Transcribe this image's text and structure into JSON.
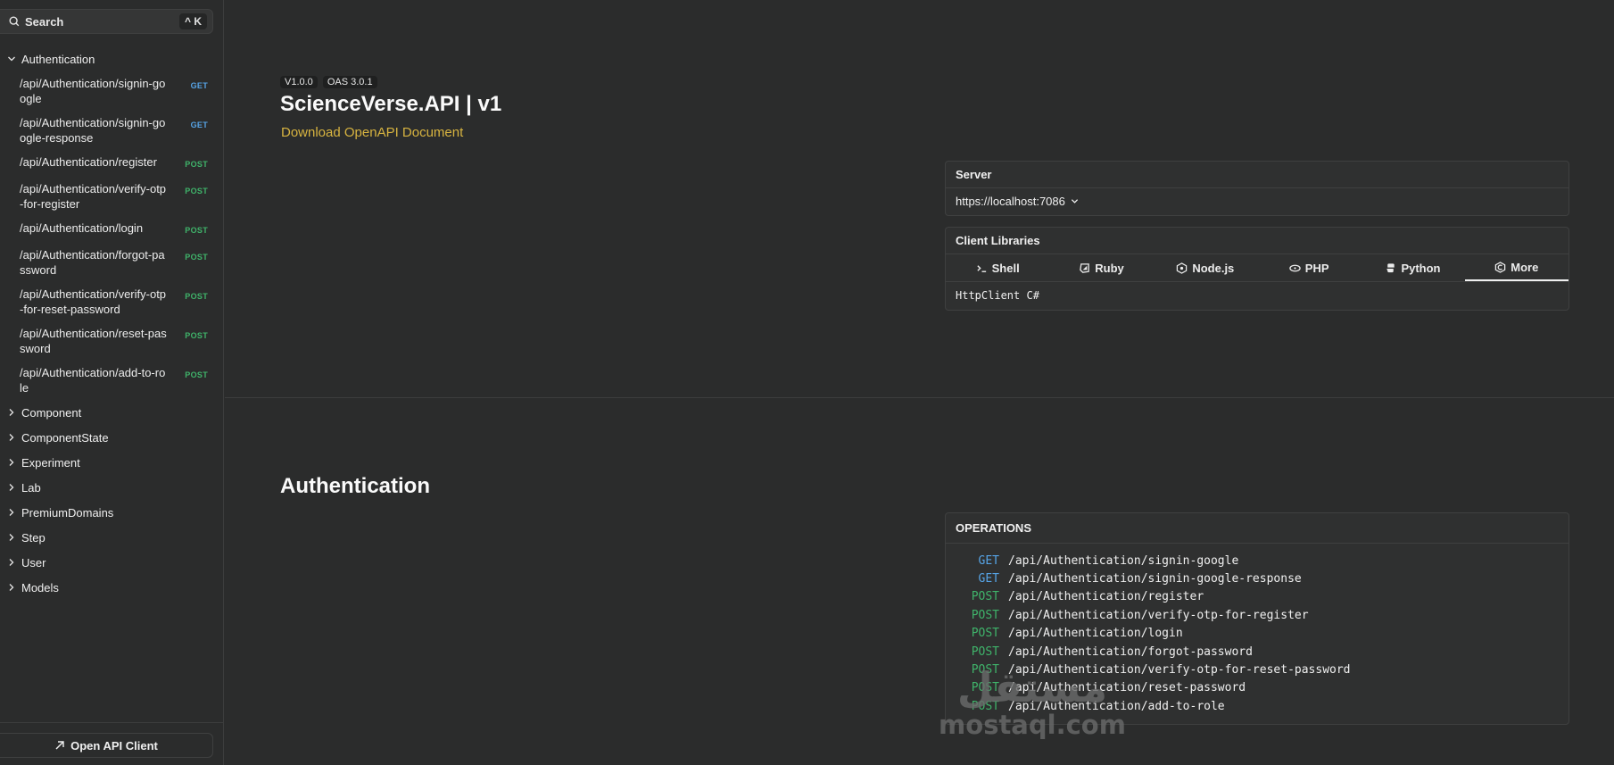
{
  "sidebar": {
    "search": {
      "label": "Search",
      "shortcut": "^ K"
    },
    "groups": [
      {
        "label": "Authentication",
        "expanded": true
      },
      {
        "label": "Component"
      },
      {
        "label": "ComponentState"
      },
      {
        "label": "Experiment"
      },
      {
        "label": "Lab"
      },
      {
        "label": "PremiumDomains"
      },
      {
        "label": "Step"
      },
      {
        "label": "User"
      },
      {
        "label": "Models"
      }
    ],
    "endpoints": [
      {
        "path": "/api/Authentication/signin-google",
        "method": "GET"
      },
      {
        "path": "/api/Authentication/signin-google-response",
        "method": "GET"
      },
      {
        "path": "/api/Authentication/register",
        "method": "POST"
      },
      {
        "path": "/api/Authentication/verify-otp-for-register",
        "method": "POST"
      },
      {
        "path": "/api/Authentication/login",
        "method": "POST"
      },
      {
        "path": "/api/Authentication/forgot-password",
        "method": "POST"
      },
      {
        "path": "/api/Authentication/verify-otp-for-reset-password",
        "method": "POST"
      },
      {
        "path": "/api/Authentication/reset-password",
        "method": "POST"
      },
      {
        "path": "/api/Authentication/add-to-role",
        "method": "POST"
      }
    ],
    "open_client_label": "Open API Client"
  },
  "header": {
    "version": "V1.0.0",
    "oas": "OAS 3.0.1",
    "title": "ScienceVerse.API | v1",
    "download_label": "Download OpenAPI Document"
  },
  "server": {
    "heading": "Server",
    "url": "https://localhost:7086"
  },
  "client_libraries": {
    "heading": "Client Libraries",
    "tabs": [
      {
        "label": "Shell",
        "icon": "terminal-icon"
      },
      {
        "label": "Ruby",
        "icon": "ruby-icon"
      },
      {
        "label": "Node.js",
        "icon": "nodejs-icon"
      },
      {
        "label": "PHP",
        "icon": "php-icon"
      },
      {
        "label": "Python",
        "icon": "python-icon"
      },
      {
        "label": "More",
        "icon": "csharp-icon",
        "active": true
      }
    ],
    "selected": "HttpClient C#"
  },
  "section": {
    "title": "Authentication",
    "operations_heading": "OPERATIONS",
    "operations": [
      {
        "method": "GET",
        "path": "/api/Authentication/signin-google"
      },
      {
        "method": "GET",
        "path": "/api/Authentication/signin-google-response"
      },
      {
        "method": "POST",
        "path": "/api/Authentication/register"
      },
      {
        "method": "POST",
        "path": "/api/Authentication/verify-otp-for-register"
      },
      {
        "method": "POST",
        "path": "/api/Authentication/login"
      },
      {
        "method": "POST",
        "path": "/api/Authentication/forgot-password"
      },
      {
        "method": "POST",
        "path": "/api/Authentication/verify-otp-for-reset-password"
      },
      {
        "method": "POST",
        "path": "/api/Authentication/reset-password"
      },
      {
        "method": "POST",
        "path": "/api/Authentication/add-to-role"
      }
    ]
  },
  "watermark": {
    "arabic": "مستقل",
    "latin": "mostaql.com"
  },
  "colors": {
    "get": "#56a4e6",
    "post": "#3fb36a",
    "link": "#d8b440"
  }
}
